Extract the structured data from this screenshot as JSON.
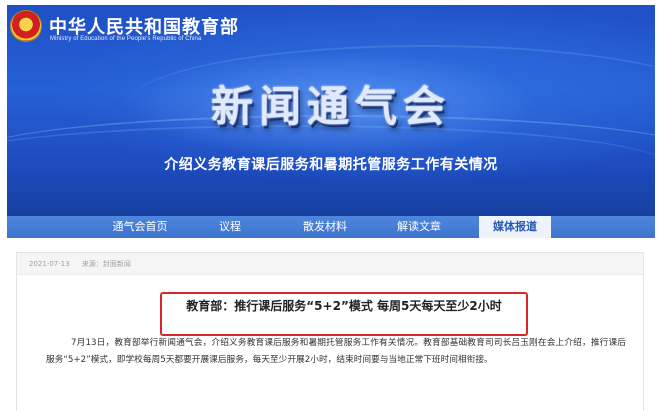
{
  "header": {
    "ministry_cn": "中华人民共和国教育部",
    "ministry_en": "Ministry of Education of the People's Republic of China",
    "title": "新闻通气会",
    "subtitle": "介绍义务教育课后服务和暑期托管服务工作有关情况"
  },
  "nav": {
    "items": [
      {
        "label": "通气会首页"
      },
      {
        "label": "议程"
      },
      {
        "label": "散发材料"
      },
      {
        "label": "解读文章"
      },
      {
        "label": "媒体报道"
      }
    ],
    "active_index": 4
  },
  "article": {
    "date": "2021-07-13",
    "source": "来源：封面新闻",
    "headline": "教育部：推行课后服务“5+2”模式 每周5天每天至少2小时",
    "body": "7月13日，教育部举行新闻通气会，介绍义务教育课后服务和暑期托管服务工作有关情况。教育部基础教育司司长吕玉刚在会上介绍，推行课后服务“5+2”模式，即学校每周5天都要开展课后服务，每天至少开展2小时，结束时间要与当地正常下班时间相衔接。"
  },
  "colors": {
    "banner_blue": "#2660d6",
    "nav_blue": "#3c74cf",
    "highlight_red": "#d9262a"
  }
}
